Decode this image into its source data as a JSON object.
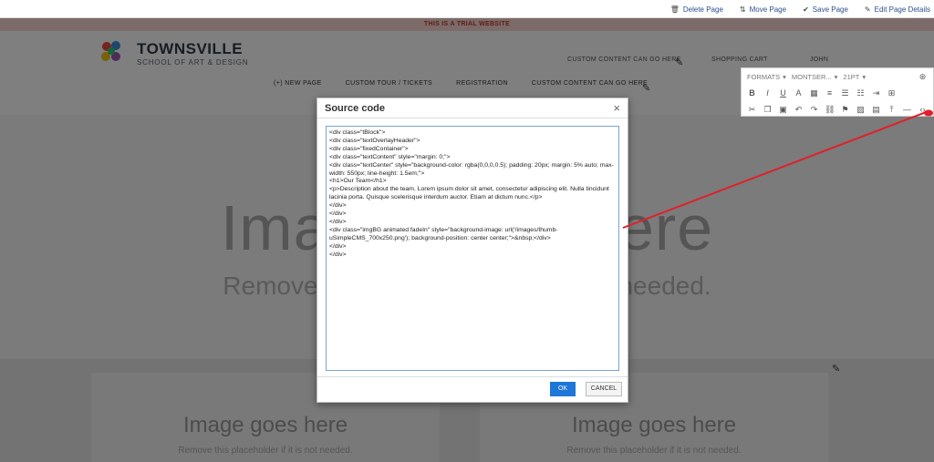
{
  "topbar": {
    "actions": [
      {
        "label": "Delete Page",
        "icon": "trash-icon"
      },
      {
        "label": "Move Page",
        "icon": "move-icon"
      },
      {
        "label": "Save Page",
        "icon": "check-circle-icon"
      },
      {
        "label": "Edit Page Details",
        "icon": "edit-icon"
      }
    ]
  },
  "page": {
    "trial_banner": "THIS IS A TRIAL WEBSITE",
    "brand": {
      "name": "TOWNSVILLE",
      "tagline": "SCHOOL OF ART & DESIGN"
    },
    "header_links": {
      "custom": "CUSTOM CONTENT CAN GO HERE",
      "cart": "SHOPPING CART",
      "user": "JOHN"
    },
    "nav": [
      "(+) NEW PAGE",
      "CUSTOM TOUR / TICKETS",
      "REGISTRATION",
      "CUSTOM CONTENT CAN GO HERE"
    ],
    "hero": {
      "title": "Image goes here",
      "subtitle": "Remove this placeholder if it is not needed."
    },
    "cards": [
      {
        "title": "Image goes here",
        "subtitle": "Remove this placeholder if it is not needed."
      },
      {
        "title": "Image goes here",
        "subtitle": "Remove this placeholder if it is not needed."
      }
    ]
  },
  "editor_toolbar": {
    "format": "FORMATS",
    "font": "MONTSER...",
    "size": "21PT"
  },
  "modal": {
    "title": "Source code",
    "code_lines": [
      "<div class=\"tBlock\">",
      "<div class=\"textOverlayHeader\">",
      "<div class=\"fixedContainer\">",
      "<div class=\"textContent\" style=\"margin: 0;\">",
      "<div class=\"textCenter\" style=\"background-color: rgba(0,0,0,0.5); padding: 20px; margin: 5% auto; max-width: 550px; line-height: 1.5em;\">",
      "<h1>Our Team</h1>",
      "<p>Description about the team. Lorem ipsum dolor sit amet, consectetur adipiscing elit. Nulla tincidunt lacinia porta. Quisque scelerisque interdum auctor. Etiam at dictum nunc.</p>",
      "</div>",
      "</div>",
      "</div>",
      "<div class=\"imgBG animated fadeIn\" style=\"background-image: url('/images/thumb-uSimpleCMS_700x250.png'); background-position: center center;\">&nbsp;</div>",
      "</div>",
      "</div>"
    ],
    "ok_label": "OK",
    "cancel_label": "CANCEL"
  }
}
